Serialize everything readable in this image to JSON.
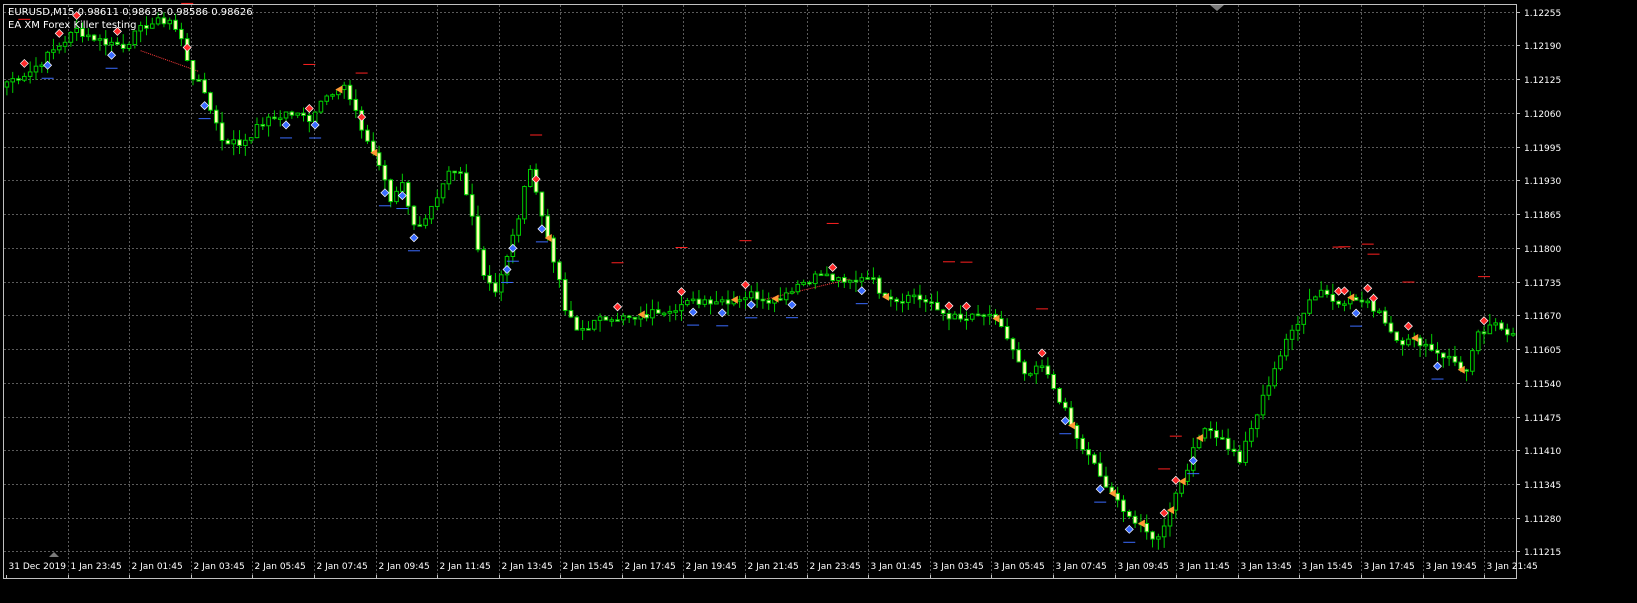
{
  "window": {
    "symbol_line": "EURUSD,M15  0.98611 0.98635 0.98586 0.98626",
    "ea_label": "EA XM Forex Killer testing"
  },
  "colors": {
    "background": "#000000",
    "grid": "#5a5a5a",
    "axis_text": "#ffffff",
    "bull_body": "#000000",
    "bear_body": "#ffffb3",
    "candle_outline": "#00cc00",
    "buy_arrow": "#3a6bff",
    "sell_arrow": "#ff2a2a",
    "order_marker": "#ff9933",
    "stop_dash": "#ff2020",
    "trend_line": "#ff3b3b"
  },
  "chart_data": {
    "type": "candlestick",
    "title": "",
    "price_axis": {
      "ticks": [
        1.12255,
        1.1219,
        1.12125,
        1.1206,
        1.11995,
        1.1193,
        1.11865,
        1.118,
        1.11735,
        1.1167,
        1.11605,
        1.1154,
        1.11475,
        1.1141,
        1.11345,
        1.1128,
        1.11215
      ],
      "range": [
        1.11212,
        1.12268
      ]
    },
    "time_axis": {
      "ticks": [
        "31 Dec 2019",
        "1 Jan 23:45",
        "2 Jan 01:45",
        "2 Jan 03:45",
        "2 Jan 05:45",
        "2 Jan 07:45",
        "2 Jan 09:45",
        "2 Jan 11:45",
        "2 Jan 13:45",
        "2 Jan 15:45",
        "2 Jan 17:45",
        "2 Jan 19:45",
        "2 Jan 21:45",
        "2 Jan 23:45",
        "3 Jan 01:45",
        "3 Jan 03:45",
        "3 Jan 05:45",
        "3 Jan 07:45",
        "3 Jan 09:45",
        "3 Jan 11:45",
        "3 Jan 13:45",
        "3 Jan 15:45",
        "3 Jan 17:45",
        "3 Jan 19:45",
        "3 Jan 21:45"
      ]
    },
    "price_path": [
      [
        0,
        1.1212
      ],
      [
        4,
        1.1214
      ],
      [
        8,
        1.1218
      ],
      [
        12,
        1.1222
      ],
      [
        16,
        1.122
      ],
      [
        20,
        1.1219
      ],
      [
        24,
        1.1223
      ],
      [
        28,
        1.1224
      ],
      [
        30,
        1.122
      ],
      [
        32,
        1.1213
      ],
      [
        34,
        1.121
      ],
      [
        37,
        1.1201
      ],
      [
        40,
        1.12
      ],
      [
        44,
        1.1204
      ],
      [
        48,
        1.1206
      ],
      [
        52,
        1.1205
      ],
      [
        55,
        1.121
      ],
      [
        58,
        1.1211
      ],
      [
        61,
        1.1203
      ],
      [
        64,
        1.1196
      ],
      [
        66,
        1.1189
      ],
      [
        68,
        1.1193
      ],
      [
        70,
        1.1184
      ],
      [
        72,
        1.1186
      ],
      [
        74,
        1.1189
      ],
      [
        76,
        1.1194
      ],
      [
        78,
        1.1194
      ],
      [
        80,
        1.1186
      ],
      [
        82,
        1.1175
      ],
      [
        84,
        1.1172
      ],
      [
        86,
        1.1178
      ],
      [
        88,
        1.1186
      ],
      [
        90,
        1.1196
      ],
      [
        92,
        1.1186
      ],
      [
        94,
        1.1178
      ],
      [
        96,
        1.1168
      ],
      [
        98,
        1.1164
      ],
      [
        100,
        1.1165
      ],
      [
        104,
        1.1167
      ],
      [
        108,
        1.1166
      ],
      [
        112,
        1.1168
      ],
      [
        116,
        1.1169
      ],
      [
        120,
        1.117
      ],
      [
        124,
        1.117
      ],
      [
        128,
        1.1171
      ],
      [
        132,
        1.117
      ],
      [
        136,
        1.1173
      ],
      [
        140,
        1.1175
      ],
      [
        144,
        1.1173
      ],
      [
        148,
        1.1175
      ],
      [
        150,
        1.1172
      ],
      [
        153,
        1.117
      ],
      [
        156,
        1.1171
      ],
      [
        160,
        1.1168
      ],
      [
        164,
        1.1166
      ],
      [
        168,
        1.1167
      ],
      [
        171,
        1.1165
      ],
      [
        173,
        1.116
      ],
      [
        175,
        1.1155
      ],
      [
        178,
        1.1157
      ],
      [
        181,
        1.1151
      ],
      [
        184,
        1.1143
      ],
      [
        187,
        1.1138
      ],
      [
        190,
        1.1132
      ],
      [
        192,
        1.113
      ],
      [
        194,
        1.1127
      ],
      [
        196,
        1.1125
      ],
      [
        198,
        1.1124
      ],
      [
        200,
        1.113
      ],
      [
        203,
        1.1138
      ],
      [
        206,
        1.1146
      ],
      [
        209,
        1.1143
      ],
      [
        212,
        1.1139
      ],
      [
        215,
        1.1148
      ],
      [
        218,
        1.1157
      ],
      [
        221,
        1.1164
      ],
      [
        224,
        1.117
      ],
      [
        226,
        1.1172
      ],
      [
        228,
        1.117
      ],
      [
        232,
        1.117
      ],
      [
        236,
        1.1168
      ],
      [
        238,
        1.1164
      ],
      [
        240,
        1.1162
      ],
      [
        243,
        1.1162
      ],
      [
        246,
        1.116
      ],
      [
        249,
        1.1158
      ],
      [
        251,
        1.1156
      ],
      [
        253,
        1.1163
      ],
      [
        256,
        1.1165
      ],
      [
        258,
        1.1164
      ]
    ],
    "series": [
      {
        "name": "",
        "kind": "trend_line",
        "points": [
          [
            23,
            1.1218
          ],
          [
            33,
            1.1214
          ]
        ]
      },
      {
        "name": "",
        "kind": "trend_line",
        "points": [
          [
            130,
            1.117
          ],
          [
            145,
            1.1174
          ]
        ]
      }
    ]
  }
}
